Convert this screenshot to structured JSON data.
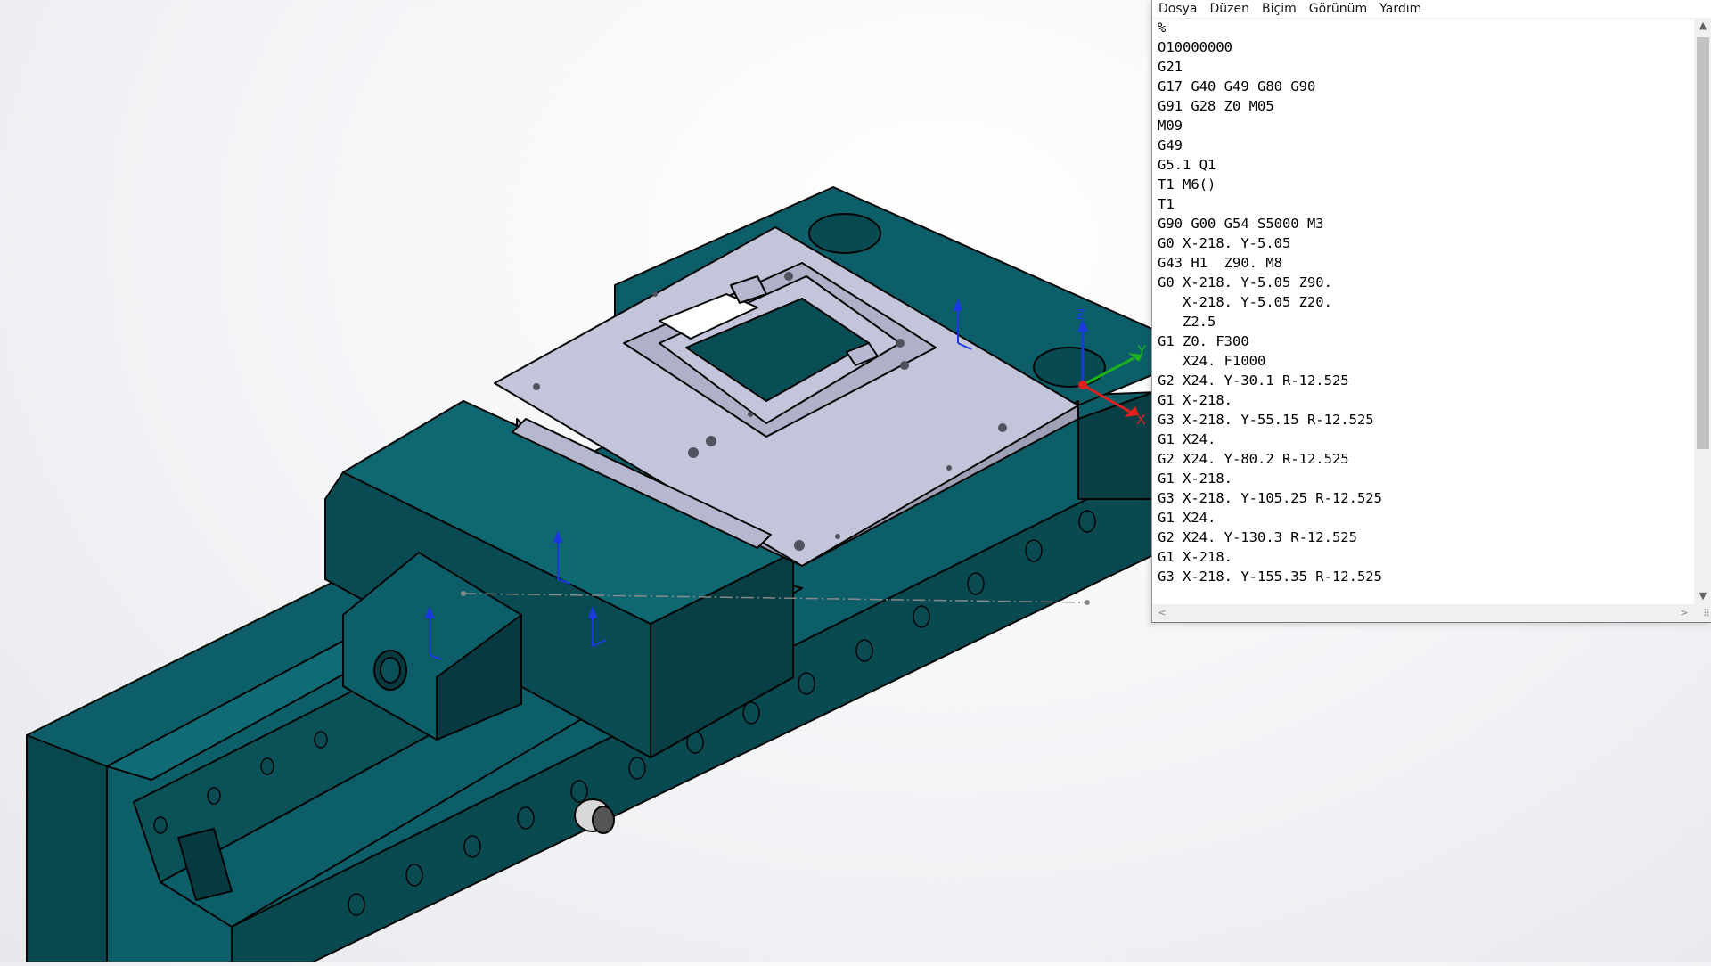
{
  "app": {
    "menu": [
      {
        "id": "file",
        "label": "Dosya"
      },
      {
        "id": "edit",
        "label": "Düzen"
      },
      {
        "id": "format",
        "label": "Biçim"
      },
      {
        "id": "view",
        "label": "Görünüm"
      },
      {
        "id": "help",
        "label": "Yardım"
      }
    ],
    "code_lines": [
      "%",
      "O10000000",
      "G21",
      "G17 G40 G49 G80 G90",
      "G91 G28 Z0 M05",
      "M09",
      "G49",
      "G5.1 Q1",
      "T1 M6()",
      "T1",
      "G90 G00 G54 S5000 M3",
      "G0 X-218. Y-5.05",
      "G43 H1  Z90. M8",
      "G0 X-218. Y-5.05 Z90.",
      "   X-218. Y-5.05 Z20.",
      "   Z2.5",
      "G1 Z0. F300",
      "   X24. F1000",
      "G2 X24. Y-30.1 R-12.525",
      "G1 X-218.",
      "G3 X-218. Y-55.15 R-12.525",
      "G1 X24.",
      "G2 X24. Y-80.2 R-12.525",
      "G1 X-218.",
      "G3 X-218. Y-105.25 R-12.525",
      "G1 X24.",
      "G2 X24. Y-130.3 R-12.525",
      "G1 X-218.",
      "G3 X-218. Y-155.35 R-12.525"
    ],
    "scroll": {
      "up": "▲",
      "down": "▼",
      "left": "<",
      "right": ">",
      "grip": "⠿"
    }
  },
  "model": {
    "colors": {
      "body": "#0c5f68",
      "dark": "#073f45",
      "plate": "#c3c5da",
      "edge": "#0a0a0a"
    },
    "triad": {
      "x_label": "X",
      "y_label": "Y",
      "z_label": "Z",
      "x_color": "#e02020",
      "y_color": "#1cb21c",
      "z_color": "#1c38e0"
    }
  }
}
